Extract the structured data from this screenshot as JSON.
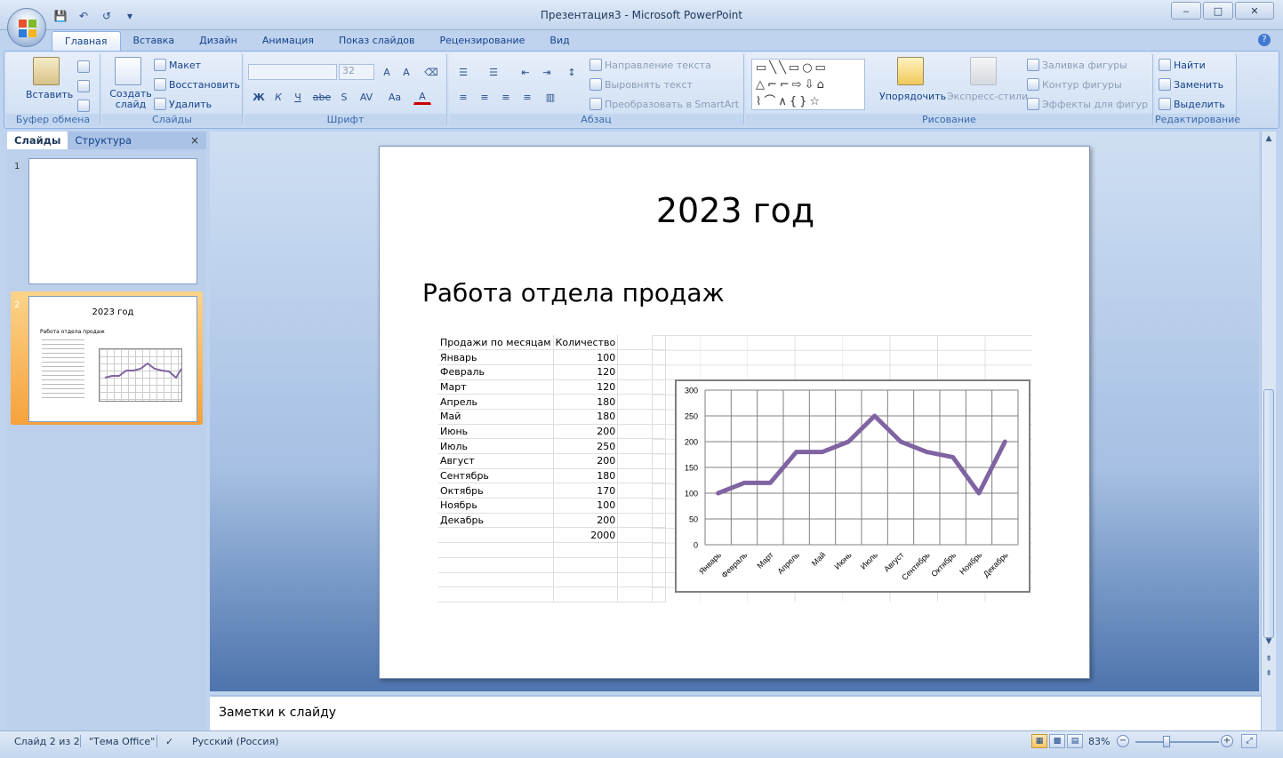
{
  "window": {
    "title": "Презентация3 - Microsoft PowerPoint",
    "min": "‒",
    "max": "□",
    "close": "✕"
  },
  "qat": {
    "save": "💾",
    "undo": "↶",
    "redo": "↺",
    "more": "▾"
  },
  "ribbon_tabs": [
    "Главная",
    "Вставка",
    "Дизайн",
    "Анимация",
    "Показ слайдов",
    "Рецензирование",
    "Вид"
  ],
  "ribbon": {
    "clipboard": {
      "paste": "Вставить",
      "label": "Буфер обмена"
    },
    "slides": {
      "new_slide": "Создать слайд",
      "layout": "Макет",
      "reset": "Восстановить",
      "delete": "Удалить",
      "label": "Слайды"
    },
    "font": {
      "size": "32",
      "label": "Шрифт",
      "bold": "Ж",
      "italic": "К",
      "underline": "Ч",
      "strike": "abe",
      "shadow": "S",
      "spacing": "AV",
      "case": "Aa",
      "color": "A"
    },
    "paragraph": {
      "text_direction": "Направление текста",
      "align_text": "Выровнять текст",
      "smartart": "Преобразовать в SmartArt",
      "label": "Абзац"
    },
    "drawing": {
      "arrange": "Упорядочить",
      "quick_styles": "Экспресс-стили",
      "shape_fill": "Заливка фигуры",
      "shape_outline": "Контур фигуры",
      "shape_effects": "Эффекты для фигур",
      "label": "Рисование"
    },
    "editing": {
      "find": "Найти",
      "replace": "Заменить",
      "select": "Выделить",
      "label": "Редактирование"
    }
  },
  "panel": {
    "tab_slides": "Слайды",
    "tab_outline": "Структура",
    "close": "×",
    "slide_numbers": [
      "1",
      "2"
    ],
    "thumb_title": "2023 год",
    "thumb_subtitle": "Работа отдела продаж"
  },
  "slide": {
    "title": "2023 год",
    "subtitle": "Работа отдела продаж",
    "table_header": [
      "Продажи по месяцам",
      "Количество"
    ],
    "table_rows": [
      [
        "Январь",
        "100"
      ],
      [
        "Февраль",
        "120"
      ],
      [
        "Март",
        "120"
      ],
      [
        "Апрель",
        "180"
      ],
      [
        "Май",
        "180"
      ],
      [
        "Июнь",
        "200"
      ],
      [
        "Июль",
        "250"
      ],
      [
        "Август",
        "200"
      ],
      [
        "Сентябрь",
        "180"
      ],
      [
        "Октябрь",
        "170"
      ],
      [
        "Ноябрь",
        "100"
      ],
      [
        "Декабрь",
        "200"
      ]
    ],
    "table_total": "2000"
  },
  "chart_data": {
    "type": "line",
    "categories": [
      "Январь",
      "Февраль",
      "Март",
      "Апрель",
      "Май",
      "Июнь",
      "Июль",
      "Август",
      "Сентябрь",
      "Октябрь",
      "Ноябрь",
      "Декабрь"
    ],
    "values": [
      100,
      120,
      120,
      180,
      180,
      200,
      250,
      200,
      180,
      170,
      100,
      200
    ],
    "ylim": [
      0,
      300
    ],
    "yticks": [
      0,
      50,
      100,
      150,
      200,
      250,
      300
    ],
    "grid": true,
    "legend": "none",
    "line_color": "#8064a2"
  },
  "notes": {
    "placeholder": "Заметки к слайду"
  },
  "status": {
    "slide": "Слайд 2 из 2",
    "theme": "\"Тема Office\"",
    "language": "Русский (Россия)",
    "zoom": "83%"
  },
  "colors": {
    "accent": "#15428b",
    "selection": "#f5a23a"
  }
}
